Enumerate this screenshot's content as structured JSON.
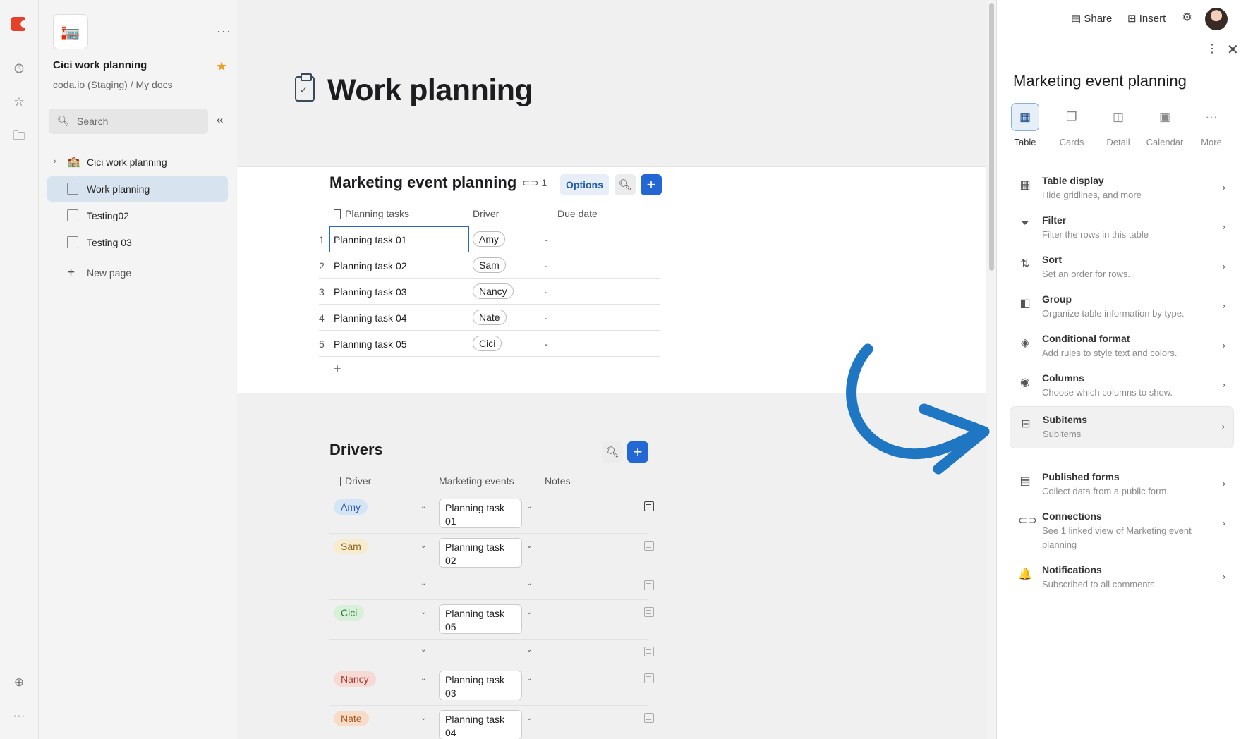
{
  "rail": {
    "icons": [
      "coda-logo-icon",
      "history-icon",
      "star-icon",
      "folder-icon",
      "add-circle-icon",
      "more-icon"
    ]
  },
  "sidebar": {
    "doc_icon": "🏣",
    "doc_title": "Cici work planning",
    "doc_path": "coda.io (Staging) / My docs",
    "more": "···",
    "search_placeholder": "Search",
    "items": [
      {
        "label": "Cici work planning",
        "icon": "🏫"
      },
      {
        "label": "Work planning"
      },
      {
        "label": "Testing02"
      },
      {
        "label": "Testing 03"
      }
    ],
    "new_page": "New page"
  },
  "main": {
    "page_title": "Work planning",
    "table1": {
      "title": "Marketing event planning",
      "link_count": "1",
      "options_label": "Options",
      "columns": [
        "Planning tasks",
        "Driver",
        "Due date"
      ],
      "rows": [
        {
          "num": "1",
          "task": "Planning task 01",
          "driver": "Amy"
        },
        {
          "num": "2",
          "task": "Planning task 02",
          "driver": "Sam"
        },
        {
          "num": "3",
          "task": "Planning task 03",
          "driver": "Nancy"
        },
        {
          "num": "4",
          "task": "Planning task 04",
          "driver": "Nate"
        },
        {
          "num": "5",
          "task": "Planning task 05",
          "driver": "Cici"
        }
      ],
      "add_row": "+"
    },
    "table2": {
      "title": "Drivers",
      "columns": [
        "Driver",
        "Marketing events",
        "Notes"
      ],
      "rows": [
        {
          "driver": "Amy",
          "color_bg": "#d6e4f7",
          "color_fg": "#2a5aa0",
          "event_l1": "Planning task",
          "event_l2": "01"
        },
        {
          "driver": "Sam",
          "color_bg": "#f7ebd0",
          "color_fg": "#8a6520",
          "event_l1": "Planning task",
          "event_l2": "02"
        },
        {
          "driver": "",
          "event_l1": "",
          "event_l2": ""
        },
        {
          "driver": "Cici",
          "color_bg": "#d8efd9",
          "color_fg": "#2f7a3a",
          "event_l1": "Planning task",
          "event_l2": "05"
        },
        {
          "driver": "",
          "event_l1": "",
          "event_l2": ""
        },
        {
          "driver": "Nancy",
          "color_bg": "#f7d9d6",
          "color_fg": "#a03a32",
          "event_l1": "Planning task",
          "event_l2": "03"
        },
        {
          "driver": "Nate",
          "color_bg": "#f9dcc8",
          "color_fg": "#a4551f",
          "event_l1": "Planning task",
          "event_l2": "04"
        }
      ]
    }
  },
  "panel": {
    "share_label": "Share",
    "insert_label": "Insert",
    "title": "Marketing event planning",
    "views": [
      "Table",
      "Cards",
      "Detail",
      "Calendar",
      "More"
    ],
    "options": [
      {
        "title": "Table display",
        "sub": "Hide gridlines, and more",
        "icon": "table-icon",
        "glyph": "▦"
      },
      {
        "title": "Filter",
        "sub": "Filter the rows in this table",
        "icon": "filter-icon",
        "glyph": "⏷"
      },
      {
        "title": "Sort",
        "sub": "Set an order for rows.",
        "icon": "sort-icon",
        "glyph": "⇅"
      },
      {
        "title": "Group",
        "sub": "Organize table information by type.",
        "icon": "group-icon",
        "glyph": "◧"
      },
      {
        "title": "Conditional format",
        "sub": "Add rules to style text and colors.",
        "icon": "paint-bucket-icon",
        "glyph": "◈"
      },
      {
        "title": "Columns",
        "sub": "Choose which columns to show.",
        "icon": "eye-icon",
        "glyph": "◉"
      },
      {
        "title": "Subitems",
        "sub": "Subitems",
        "icon": "subitems-icon",
        "glyph": "⊟"
      },
      {
        "title": "Published forms",
        "sub": "Collect data from a public form.",
        "icon": "form-icon",
        "glyph": "▤"
      },
      {
        "title": "Connections",
        "sub": "See 1 linked view of Marketing event planning",
        "icon": "link-icon",
        "glyph": "⊂⊃"
      },
      {
        "title": "Notifications",
        "sub": "Subscribed to all comments",
        "icon": "bell-icon",
        "glyph": "🔔"
      }
    ]
  },
  "accent_color": "#2367d4",
  "annotation_arrow_color": "#1f77c4"
}
